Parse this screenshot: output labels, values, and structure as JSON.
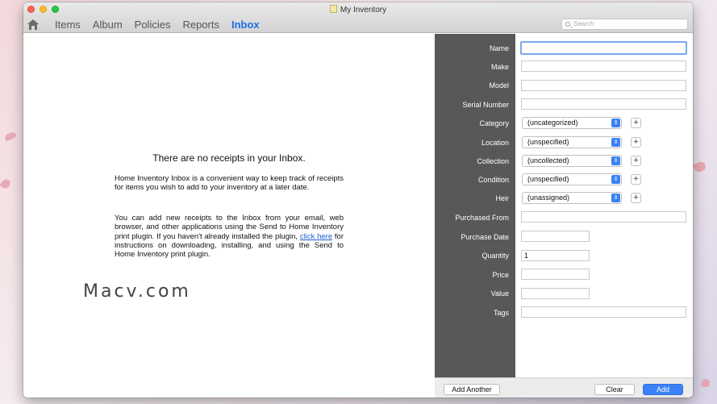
{
  "window": {
    "title": "My Inventory"
  },
  "tabs": [
    {
      "label": "Items"
    },
    {
      "label": "Album"
    },
    {
      "label": "Policies"
    },
    {
      "label": "Reports"
    },
    {
      "label": "Inbox"
    }
  ],
  "active_tab": "Inbox",
  "search": {
    "placeholder": "Search"
  },
  "inbox": {
    "empty_title": "There are no receipts in your Inbox.",
    "paragraph1": "Home Inventory Inbox is a convenient way to keep track of receipts for items you wish to add to your inventory at a later date.",
    "paragraph2_before": "You can add new receipts to the Inbox from your email, web browser, and other applications using the Send to Home Inventory print plugin. If you haven't already installed the plugin, ",
    "paragraph2_link": "click here",
    "paragraph2_after": " for instructions on downloading, installing, and using the Send to Home Inventory print plugin."
  },
  "watermark": "Macv.com",
  "form": {
    "labels": {
      "name": "Name",
      "make": "Make",
      "model": "Model",
      "serial": "Serial Number",
      "category": "Category",
      "location": "Location",
      "collection": "Collection",
      "condition": "Condition",
      "heir": "Heir",
      "purchased_from": "Purchased From",
      "purchase_date": "Purchase Date",
      "quantity": "Quantity",
      "price": "Price",
      "value": "Value",
      "tags": "Tags"
    },
    "values": {
      "name": "",
      "make": "",
      "model": "",
      "serial": "",
      "category": "(uncategorized)",
      "location": "(unspecified)",
      "collection": "(uncollected)",
      "condition": "(unspecified)",
      "heir": "(unassigned)",
      "purchased_from": "",
      "purchase_date": "",
      "quantity": "1",
      "price": "",
      "value": "",
      "tags": ""
    },
    "plus_symbol": "+",
    "popup_arrows": "⇕"
  },
  "buttons": {
    "add_another": "Add Another",
    "clear": "Clear",
    "add": "Add"
  },
  "colors": {
    "accent": "#3b82f6",
    "active_tab": "#1a6fe0",
    "label_panel": "#585858"
  }
}
